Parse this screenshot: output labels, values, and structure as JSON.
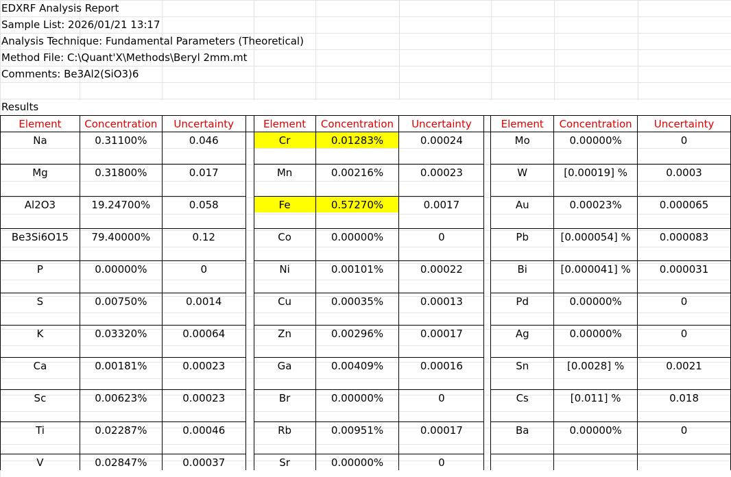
{
  "header": {
    "title": "EDXRF Analysis Report",
    "sample_list": "Sample List: 2026/01/21 13:17",
    "technique": "Analysis Technique: Fundamental Parameters (Theoretical)",
    "method_file": "Method File: C:\\Quant'X\\Methods\\Beryl 2mm.mt",
    "comments": "Comments: Be3Al2(SiO3)6"
  },
  "results_label": "Results",
  "columns": {
    "element": "Element",
    "concentration": "Concentration",
    "uncertainty": "Uncertainty"
  },
  "highlight_color": "#ffff00",
  "header_color": "#e00000",
  "rows": [
    [
      {
        "element": "Na",
        "concentration": "0.31100%",
        "uncertainty": "0.046"
      },
      {
        "element": "Cr",
        "concentration": "0.01283%",
        "uncertainty": "0.00024",
        "highlight": true
      },
      {
        "element": "Mo",
        "concentration": "0.00000%",
        "uncertainty": "0"
      }
    ],
    [
      {
        "element": "Mg",
        "concentration": "0.31800%",
        "uncertainty": "0.017"
      },
      {
        "element": "Mn",
        "concentration": "0.00216%",
        "uncertainty": "0.00023"
      },
      {
        "element": "W",
        "concentration": "[0.00019] %",
        "uncertainty": "0.0003"
      }
    ],
    [
      {
        "element": "Al2O3",
        "concentration": "19.24700%",
        "uncertainty": "0.058"
      },
      {
        "element": "Fe",
        "concentration": "0.57270%",
        "uncertainty": "0.0017",
        "highlight": true
      },
      {
        "element": "Au",
        "concentration": "0.00023%",
        "uncertainty": "0.000065"
      }
    ],
    [
      {
        "element": "Be3Si6O15",
        "concentration": "79.40000%",
        "uncertainty": "0.12"
      },
      {
        "element": "Co",
        "concentration": "0.00000%",
        "uncertainty": "0"
      },
      {
        "element": "Pb",
        "concentration": "[0.000054] %",
        "uncertainty": "0.000083"
      }
    ],
    [
      {
        "element": "P",
        "concentration": "0.00000%",
        "uncertainty": "0"
      },
      {
        "element": "Ni",
        "concentration": "0.00101%",
        "uncertainty": "0.00022"
      },
      {
        "element": "Bi",
        "concentration": "[0.000041] %",
        "uncertainty": "0.000031"
      }
    ],
    [
      {
        "element": "S",
        "concentration": "0.00750%",
        "uncertainty": "0.0014"
      },
      {
        "element": "Cu",
        "concentration": "0.00035%",
        "uncertainty": "0.00013"
      },
      {
        "element": "Pd",
        "concentration": "0.00000%",
        "uncertainty": "0"
      }
    ],
    [
      {
        "element": "K",
        "concentration": "0.03320%",
        "uncertainty": "0.00064"
      },
      {
        "element": "Zn",
        "concentration": "0.00296%",
        "uncertainty": "0.00017"
      },
      {
        "element": "Ag",
        "concentration": "0.00000%",
        "uncertainty": "0"
      }
    ],
    [
      {
        "element": "Ca",
        "concentration": "0.00181%",
        "uncertainty": "0.00023"
      },
      {
        "element": "Ga",
        "concentration": "0.00409%",
        "uncertainty": "0.00016"
      },
      {
        "element": "Sn",
        "concentration": "[0.0028] %",
        "uncertainty": "0.0021"
      }
    ],
    [
      {
        "element": "Sc",
        "concentration": "0.00623%",
        "uncertainty": "0.00023"
      },
      {
        "element": "Br",
        "concentration": "0.00000%",
        "uncertainty": "0"
      },
      {
        "element": "Cs",
        "concentration": "[0.011] %",
        "uncertainty": "0.018"
      }
    ],
    [
      {
        "element": "Ti",
        "concentration": "0.02287%",
        "uncertainty": "0.00046"
      },
      {
        "element": "Rb",
        "concentration": "0.00951%",
        "uncertainty": "0.00017"
      },
      {
        "element": "Ba",
        "concentration": "0.00000%",
        "uncertainty": "0"
      }
    ],
    [
      {
        "element": "V",
        "concentration": "0.02847%",
        "uncertainty": "0.00037"
      },
      {
        "element": "Sr",
        "concentration": "0.00000%",
        "uncertainty": "0"
      },
      {
        "element": "",
        "concentration": "",
        "uncertainty": ""
      }
    ]
  ]
}
